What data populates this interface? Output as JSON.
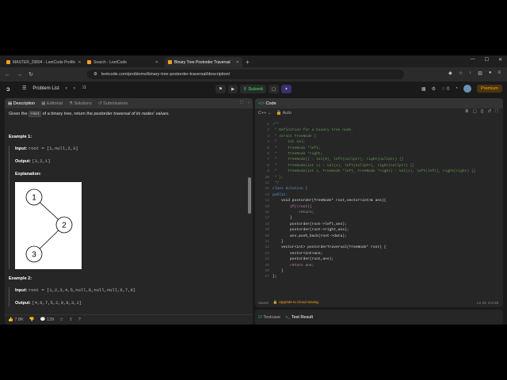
{
  "browser": {
    "tabs": [
      {
        "label": "MASTER_29894 - LeetCode Profile",
        "active": false
      },
      {
        "label": "Search - LeetCode",
        "active": false
      },
      {
        "label": "Binary Tree Postorder Traversal",
        "active": true
      }
    ],
    "new_tab": "+",
    "url": "leetcode.com/problems/binary-tree-postorder-traversal/description/"
  },
  "toolbar": {
    "problem_list": "Problem List",
    "submit": "Submit",
    "premium": "Premium",
    "notifications": "0"
  },
  "left": {
    "tabs": [
      "Description",
      "Editorial",
      "Solutions",
      "Submissions"
    ],
    "statement_pre": "Given the",
    "statement_code": "root",
    "statement_post": "of a binary tree, return",
    "statement_em": "the postorder traversal of its nodes' values.",
    "example1": {
      "heading": "Example 1:",
      "input_label": "Input:",
      "input": "root = [1,null,2,3]",
      "output_label": "Output:",
      "output": "[3,2,1]",
      "explanation_label": "Explanation:",
      "tree_nodes": [
        "1",
        "2",
        "3"
      ]
    },
    "example2": {
      "heading": "Example 2:",
      "input_label": "Input:",
      "input": "root = [1,2,3,4,5,null,8,null,null,6,7,9]",
      "output_label": "Output:",
      "output": "[4,6,7,5,2,9,8,3,1]"
    },
    "footer": {
      "likes": "7.8K",
      "comments": "139"
    }
  },
  "right": {
    "title": "Code",
    "language": "C++",
    "mode": "Auto",
    "footer_saved": "Saved",
    "upgrade": "Upgrade to Cloud Saving",
    "cursor": "Ln 20, Col 25",
    "bottom_tabs": [
      "Testcase",
      "Test Result"
    ],
    "code_lines": [
      {
        "n": "1",
        "t": "/**",
        "c": "cm"
      },
      {
        "n": "2",
        "t": " * Definition for a binary tree node.",
        "c": "cm"
      },
      {
        "n": "3",
        "t": " * struct TreeNode {",
        "c": "cm"
      },
      {
        "n": "4",
        "t": " *     int val;",
        "c": "cm"
      },
      {
        "n": "5",
        "t": " *     TreeNode *left;",
        "c": "cm"
      },
      {
        "n": "6",
        "t": " *     TreeNode *right;",
        "c": "cm"
      },
      {
        "n": "7",
        "t": " *     TreeNode() : val(0), left(nullptr), right(nullptr) {}",
        "c": "cm"
      },
      {
        "n": "8",
        "t": " *     TreeNode(int x) : val(x), left(nullptr), right(nullptr) {}",
        "c": "cm"
      },
      {
        "n": "9",
        "t": " *     TreeNode(int x, TreeNode *left, TreeNode *right) : val(x), left(left), right(right) {}",
        "c": "cm"
      },
      {
        "n": "10",
        "t": " * };",
        "c": "cm"
      },
      {
        "n": "11",
        "t": " */",
        "c": "cm"
      },
      {
        "n": "12",
        "t": "class Solution {",
        "c": "kw"
      },
      {
        "n": "13",
        "t": "public:",
        "c": "kw"
      },
      {
        "n": "14",
        "t": "    void postorder(TreeNode* root,vector<int>& ans){",
        "c": ""
      },
      {
        "n": "15",
        "t": "        if(!root){",
        "c": "ctrl"
      },
      {
        "n": "16",
        "t": "            return;",
        "c": "ctrl"
      },
      {
        "n": "17",
        "t": "        }",
        "c": ""
      },
      {
        "n": "18",
        "t": "        postorder(root->left,ans);",
        "c": ""
      },
      {
        "n": "19",
        "t": "        postorder(root->right,ans);",
        "c": ""
      },
      {
        "n": "20",
        "t": "        ans.push_back(root->data);",
        "c": ""
      },
      {
        "n": "21",
        "t": "    }",
        "c": ""
      },
      {
        "n": "22",
        "t": "    vector<int> postorderTraversal(TreeNode* root) {",
        "c": ""
      },
      {
        "n": "23",
        "t": "        vector<int>ans;",
        "c": ""
      },
      {
        "n": "24",
        "t": "        postorder(root,ans);",
        "c": ""
      },
      {
        "n": "25",
        "t": "        return ans;",
        "c": "ctrl"
      },
      {
        "n": "26",
        "t": "    }",
        "c": ""
      },
      {
        "n": "27",
        "t": "};",
        "c": ""
      }
    ]
  }
}
